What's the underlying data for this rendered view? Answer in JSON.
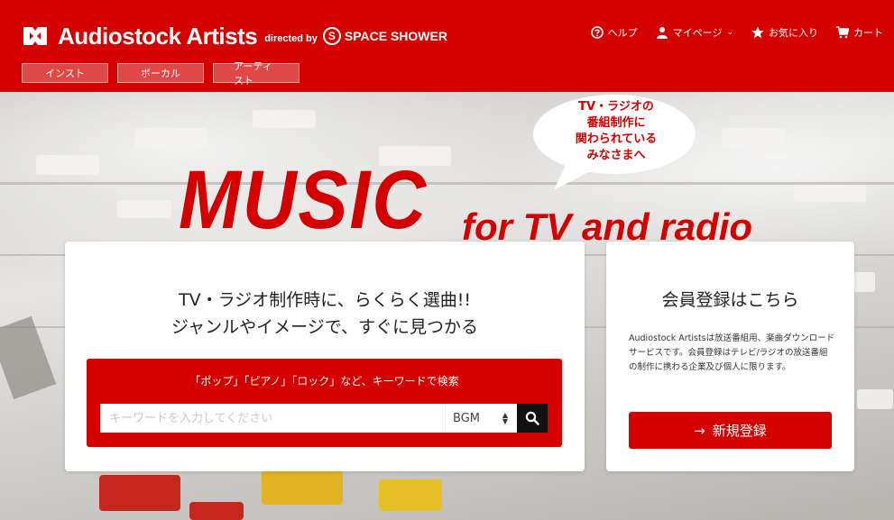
{
  "header": {
    "logo_name": "Audiostock Artists",
    "logo_directed_by": "directed by",
    "logo_brand_letter": "S",
    "logo_brand": "SPACE SHOWER",
    "nav": [
      {
        "label": "ヘルプ",
        "icon": "help-circle-icon"
      },
      {
        "label": "マイページ",
        "icon": "user-icon",
        "chevron": "⌄"
      },
      {
        "label": "お気に入り",
        "icon": "star-icon"
      },
      {
        "label": "カート",
        "icon": "cart-icon"
      }
    ],
    "category_tabs": [
      "インスト",
      "ボーカル",
      "アーティスト"
    ]
  },
  "hero": {
    "speech_bubble": [
      "TV・ラジオの",
      "番組制作に",
      "関わられている",
      "みなさまへ"
    ],
    "music": "MUSIC",
    "music_sub": "for TV and radio"
  },
  "search_card": {
    "headline_1": "TV・ラジオ制作時に、らくらく選曲!!",
    "headline_2": "ジャンルやイメージで、すぐに見つかる",
    "hint": "「ポップ」「ピアノ」「ロック」など、キーワードで検索",
    "input_placeholder": "キーワードを入力してください",
    "input_value": "",
    "select_value": "BGM",
    "search_icon": "search-icon"
  },
  "register_card": {
    "title": "会員登録はこちら",
    "description": "Audiostock Artistsは放送番組用、楽曲ダウンロードサービスです。会員登録はテレビ/ラジオの放送番組の制作に携わる企業及び個人に限ります。",
    "button_arrow": "→",
    "button_label": "新規登録"
  },
  "colors": {
    "brand_red": "#d40000",
    "text_dark": "#222222",
    "search_button": "#111111"
  }
}
